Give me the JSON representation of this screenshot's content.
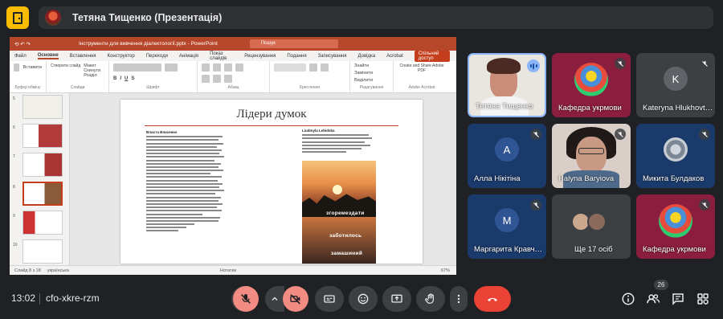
{
  "meeting": {
    "presenter_title": "Тетяна Тищенко (Презентація)",
    "time": "13:02",
    "code": "cfo-xkre-rzm",
    "participant_count": "26"
  },
  "powerpoint": {
    "window_title": "Інструменти для вивчення діалектології.pptx  -  PowerPoint",
    "search_placeholder": "Пошук",
    "menu": [
      "Файл",
      "Основне",
      "Вставлення",
      "Конструктор",
      "Переходи",
      "Анімація",
      "Показ слайдів",
      "Рецензування",
      "Подання",
      "Записування",
      "Довідка",
      "Acrobat"
    ],
    "shared_label": "Спільний доступ",
    "ribbon_groups": [
      "Буфер обміну",
      "Слайди",
      "Шрифт",
      "Абзац",
      "Креслення",
      "Редагування",
      "Adobe Acrobat"
    ],
    "ribbon_items": {
      "paste": "Вставити",
      "new_slide": "Створити слайд",
      "layout": "Макет",
      "reset": "Скинути",
      "section": "Розділ",
      "find": "Знайти",
      "replace": "Замінити",
      "select": "Виділити",
      "create_share": "Create and Share Adobe PDF"
    },
    "slide_numbers": [
      "5",
      "6",
      "7",
      "8",
      "9",
      "10"
    ],
    "status": {
      "slide": "Слайд 8 з 18",
      "language": "українська",
      "notes": "Нотатки",
      "zoom": "67%"
    }
  },
  "slide": {
    "title": "Лідери думок",
    "post1_author": "Власта Власенко",
    "post2_author": "Liudmyla Lebidska",
    "photo_words": [
      "згоремездати",
      "заботилось",
      "замашиний"
    ]
  },
  "participants": [
    {
      "name": "Тетяна Тищенко",
      "kind": "video-speaking"
    },
    {
      "name": "Кафедра укрмови",
      "kind": "flag",
      "muted": true
    },
    {
      "name": "Kateryna Hlukhovt…",
      "kind": "initial",
      "initial": "K",
      "color": "#5f6368",
      "muted": true
    },
    {
      "name": "Алла Нікітіна",
      "kind": "initial",
      "initial": "A",
      "color": "#3c5a9a",
      "muted": true
    },
    {
      "name": "Halyna Baryiova",
      "kind": "video",
      "muted": true
    },
    {
      "name": "Микита Булдаков",
      "kind": "avatar-img",
      "muted": true
    },
    {
      "name": "Маргарита Кравч…",
      "kind": "initial",
      "initial": "M",
      "color": "#3c5a9a",
      "muted": true
    },
    {
      "name": "Ще 17 осіб",
      "kind": "more"
    },
    {
      "name": "Кафедра укрмови",
      "kind": "flag",
      "muted": true
    }
  ],
  "icons": {
    "app": "meet-door-icon",
    "mic": "mic-off-icon",
    "camera": "camera-off-icon",
    "captions": "captions-icon",
    "emoji": "emoji-icon",
    "present": "present-screen-icon",
    "hand": "raise-hand-icon",
    "more": "more-vert-icon",
    "hangup": "hangup-icon",
    "info": "info-icon",
    "people": "people-icon",
    "chat": "chat-icon",
    "activities": "activities-icon"
  },
  "colors": {
    "background": "#202124",
    "control": "#3c4043",
    "muted_red": "#f28b82",
    "hangup": "#ea4335",
    "accent_blue": "#8ab4f8",
    "powerpoint": "#b7472a"
  }
}
